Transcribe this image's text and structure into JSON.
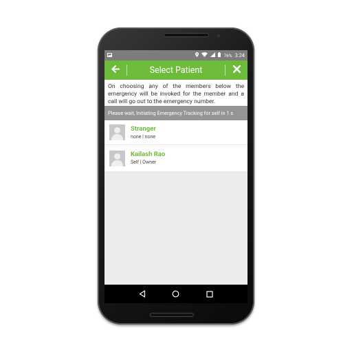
{
  "status_bar": {
    "battery_percent": "76%",
    "time": "3:24",
    "icons": [
      "image-notification-icon",
      "location-icon",
      "wifi-icon",
      "signal-icon",
      "battery-icon"
    ]
  },
  "toolbar": {
    "title": "Select Patient",
    "back_icon": "arrow-left-icon",
    "close_icon": "close-icon"
  },
  "info_text": "On choosing any of the members below the emergency will be invoked for the member and a call will go out to the emergency number.",
  "banner_text": "Please wait, Initiating Emergency Tracking for self in 1 s",
  "members": [
    {
      "name": "Stranger",
      "detail": "none | none"
    },
    {
      "name": "Kailash Rao",
      "detail": "Self | Owner"
    }
  ],
  "nav_bar": {
    "buttons": [
      "back-icon",
      "home-icon",
      "recents-icon"
    ]
  },
  "colors": {
    "accent": "#6ebb3c",
    "status_bar": "#7d7d7d",
    "banner": "#959595"
  }
}
